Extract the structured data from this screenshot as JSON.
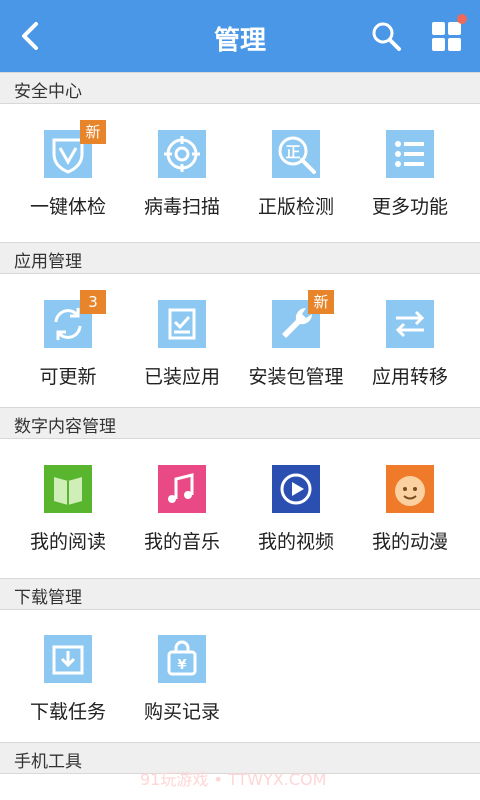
{
  "header": {
    "title": "管理",
    "back_icon": "back-arrow-icon",
    "search_icon": "search-icon",
    "menu_icon": "grid-icon"
  },
  "sections": {
    "security": {
      "title": "安全中心",
      "items": [
        {
          "label": "一键体检",
          "badge": "新",
          "icon": "shield-check-icon"
        },
        {
          "label": "病毒扫描",
          "icon": "target-icon"
        },
        {
          "label": "正版检测",
          "icon": "magnifier-zheng-icon"
        },
        {
          "label": "更多功能",
          "icon": "list-icon"
        }
      ]
    },
    "apps": {
      "title": "应用管理",
      "items": [
        {
          "label": "可更新",
          "badge": "3",
          "icon": "refresh-icon"
        },
        {
          "label": "已装应用",
          "icon": "installed-icon"
        },
        {
          "label": "安装包管理",
          "badge": "新",
          "icon": "wrench-icon"
        },
        {
          "label": "应用转移",
          "icon": "transfer-icon"
        }
      ]
    },
    "content": {
      "title": "数字内容管理",
      "items": [
        {
          "label": "我的阅读",
          "icon": "book-icon",
          "color": "#5ab52e"
        },
        {
          "label": "我的音乐",
          "icon": "music-icon",
          "color": "#e94a86"
        },
        {
          "label": "我的视频",
          "icon": "video-icon",
          "color": "#2a4fb0"
        },
        {
          "label": "我的动漫",
          "icon": "face-icon",
          "color": "#ee7a2a"
        }
      ]
    },
    "download": {
      "title": "下载管理",
      "items": [
        {
          "label": "下载任务",
          "icon": "download-icon"
        },
        {
          "label": "购买记录",
          "icon": "bag-icon"
        }
      ]
    },
    "tools": {
      "title": "手机工具"
    }
  },
  "watermark": "91玩游戏 • TTWYX.COM",
  "colors": {
    "topbar": "#4a97e8",
    "badge": "#e8842a",
    "tile_blue": "#8cc8f2"
  }
}
